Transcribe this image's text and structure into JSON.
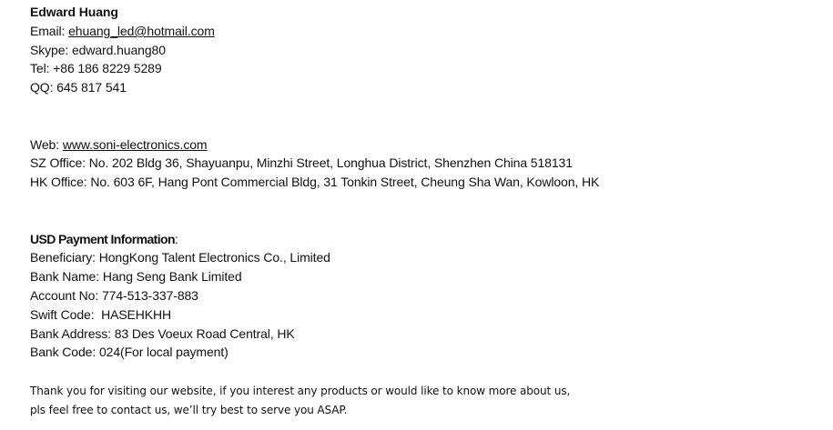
{
  "contact": {
    "name": "Edward Huang",
    "email_label": "Email: ",
    "email": "ehuang_led@hotmail.com",
    "skype": "Skype: edward.huang80",
    "tel": "Tel: +86 186 8229 5289",
    "qq": "QQ: 645 817 541"
  },
  "company": {
    "web_label": "Web: ",
    "web": "www.soni-electronics.com",
    "sz_office": "SZ Office: No. 202 Bldg 36, Shayuanpu, Minzhi Street, Longhua District, Shenzhen China 518131",
    "hk_office": "HK Office: No. 603 6F, Hang Pont Commercial Bldg, 31 Tonkin Street, Cheung Sha Wan, Kowloon, HK"
  },
  "payment": {
    "heading": "USD Payment Information",
    "heading_suffix": ":",
    "beneficiary": "Beneficiary: HongKong Talent Electronics Co., Limited",
    "bank_name": "Bank Name: Hang Seng Bank Limited",
    "account_no": "Account No: 774-513-337-883",
    "swift_code": "Swift Code:  HASEHKHH",
    "bank_address": "Bank Address: 83 Des Voeux Road Central, HK",
    "bank_code": "Bank Code: 024(For local payment)"
  },
  "footer": {
    "line1": "Thank you for visiting our website, if you interest any products or would like to know more about us,",
    "line2": "pls feel free to contact us, we’ll try best to serve you ASAP."
  }
}
